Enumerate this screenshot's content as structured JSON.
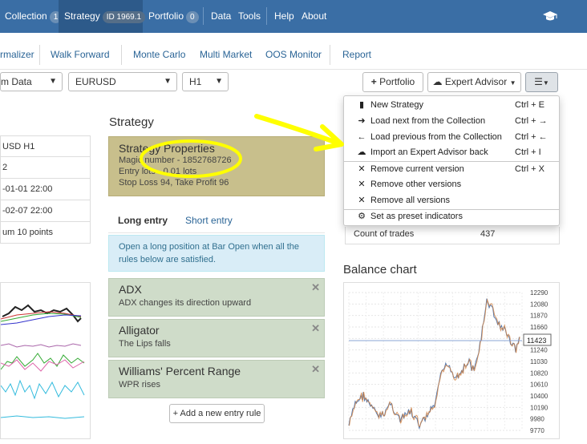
{
  "topnav": {
    "collection_label": "Collection",
    "collection_count": "1",
    "strategy_label": "Strategy",
    "strategy_id": "ID 1969.1",
    "portfolio_label": "Portfolio",
    "portfolio_count": "0",
    "data_label": "Data",
    "tools_label": "Tools",
    "help_label": "Help",
    "about_label": "About",
    "bg_color": "#3a6ea5"
  },
  "subnav": {
    "items": [
      "rmalizer",
      "Walk Forward",
      "Monte Carlo",
      "Multi Market",
      "OOS Monitor",
      "Report"
    ]
  },
  "toolbar": {
    "data_source": "m Data",
    "symbol": "EURUSD",
    "period": "H1",
    "portfolio_button": "Portfolio",
    "expert_advisor_button": "Expert Advisor"
  },
  "left": {
    "rows": [
      "USD H1",
      "2",
      "-01-01 22:00",
      "-02-07 22:00",
      "um 10 points"
    ]
  },
  "strategy": {
    "title": "Strategy",
    "properties_title": "Strategy Properties",
    "magic_number": "Magic number - 1852768726",
    "entry_lots": "Entry lots - 0.01 lots",
    "stops": "Stop Loss 94, Take Profit 96"
  },
  "tabs": {
    "long_entry": "Long entry",
    "short_entry": "Short entry"
  },
  "info": "Open a long position at Bar Open when all the rules below are satisfied.",
  "rules": [
    {
      "title": "ADX",
      "desc": "ADX changes its direction upward"
    },
    {
      "title": "Alligator",
      "desc": "The Lips falls"
    },
    {
      "title": "Williams' Percent Range",
      "desc": "WPR rises"
    }
  ],
  "add_rule": "Add a new entry rule",
  "stats": {
    "count_label": "Count of trades",
    "count_value": "437"
  },
  "balance": {
    "title": "Balance chart",
    "y_ticks": [
      "12290",
      "12080",
      "11870",
      "11660",
      "11450",
      "11240",
      "11030",
      "10820",
      "10610",
      "10400",
      "10190",
      "9980",
      "9770"
    ],
    "current_value": "11423"
  },
  "menu": {
    "items": [
      {
        "icon": "document-icon",
        "label": "New Strategy",
        "shortcut": "Ctrl + E"
      },
      {
        "icon": "arrow-right-icon",
        "label": "Load next from the Collection",
        "shortcut": "Ctrl + →"
      },
      {
        "icon": "arrow-left-icon",
        "label": "Load previous from the Collection",
        "shortcut": "Ctrl + ←"
      },
      {
        "icon": "cloud-upload-icon",
        "label": "Import an Expert Advisor back",
        "shortcut": "Ctrl + I"
      },
      {
        "icon": "close-icon",
        "label": "Remove current version",
        "shortcut": "Ctrl + X"
      },
      {
        "icon": "close-icon",
        "label": "Remove other versions",
        "shortcut": ""
      },
      {
        "icon": "close-icon",
        "label": "Remove all versions",
        "shortcut": ""
      },
      {
        "icon": "gear-icon",
        "label": "Set as preset indicators",
        "shortcut": ""
      }
    ]
  },
  "colors": {
    "accent": "#3a6ea5",
    "properties_bg": "#c8bf8c",
    "rule_bg": "#cfdcc9",
    "info_bg": "#d9edf7",
    "annotation": "#ffff00"
  }
}
